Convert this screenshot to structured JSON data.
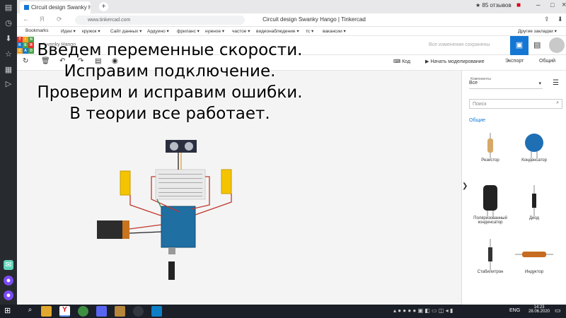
{
  "browser": {
    "tab_title": "Circuit design Swanky H",
    "window_title": "Circuit design Swanky Hango | Tinkercad",
    "url": "www.tinkercad.com",
    "reviews": "★ 85 отзывов"
  },
  "bookmarks": [
    "Bookmarks",
    "Идеи ▾",
    "кружок ▾",
    "Сайт данных ▾",
    "Ардуино ▾",
    "фриланс ▾",
    "нужное ▾",
    "частое ▾",
    "видеонаблюдение ▾",
    "тс ▾",
    "вакансии ▾"
  ],
  "bookmarks_other": "Другие закладки ▾",
  "tinkercad": {
    "logo": [
      "TIN",
      "KER",
      "CAD"
    ],
    "design_name": "Swanky Hango",
    "saved": "Все изменения сохранены"
  },
  "toolbar": {
    "code": "Код",
    "simulate": "Начать моделирование",
    "export": "Экспорт",
    "share": "Общий"
  },
  "overlay": [
    "Введем переменные скорости.",
    "Исправим подключение.",
    "Проверим и исправим ошибки.",
    "В теории все работает."
  ],
  "panel": {
    "components_label": "Компоненты",
    "filter": "Все",
    "search_placeholder": "Поиск",
    "section": "Общие",
    "items": [
      "Резистор",
      "Конденсатор",
      "Поляризованный конденсатор",
      "Диод",
      "Стабилитрон",
      "Индуктор"
    ]
  },
  "tray": {
    "lang": "ENG",
    "time": "14:23",
    "date": "28.06.2020"
  },
  "colors": {
    "accent": "#1477d4",
    "tinkercad_blue": "#1477d4"
  }
}
